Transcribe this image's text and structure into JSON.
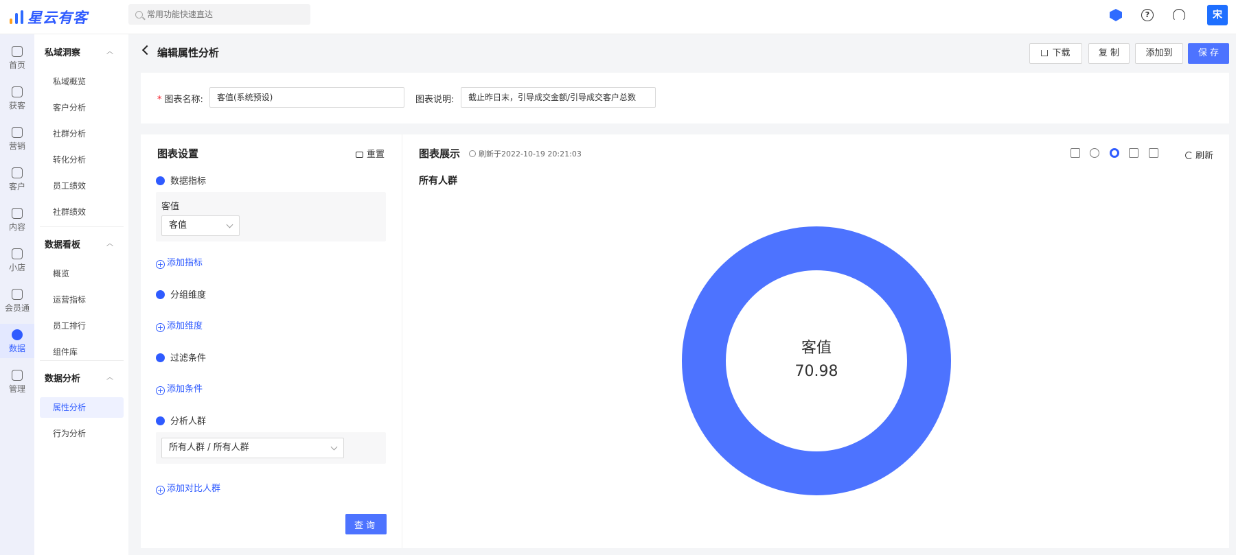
{
  "app": {
    "logo_text": "星云有客",
    "search_placeholder": "常用功能快速直达",
    "avatar_text": "宋"
  },
  "rail": [
    {
      "label": "首页",
      "icon": "home-icon"
    },
    {
      "label": "获客",
      "icon": "acquire-icon"
    },
    {
      "label": "营销",
      "icon": "bulb-icon"
    },
    {
      "label": "客户",
      "icon": "user-icon"
    },
    {
      "label": "内容",
      "icon": "folder-icon"
    },
    {
      "label": "小店",
      "icon": "shop-icon"
    },
    {
      "label": "会员通",
      "icon": "member-icon"
    },
    {
      "label": "数据",
      "icon": "pie-icon",
      "active": true
    },
    {
      "label": "管理",
      "icon": "grid-icon"
    }
  ],
  "subnav": {
    "groups": [
      {
        "title": "私域洞察",
        "items": [
          "私域概览",
          "客户分析",
          "社群分析",
          "转化分析",
          "员工绩效",
          "社群绩效"
        ]
      },
      {
        "title": "数据看板",
        "items": [
          "概览",
          "运营指标",
          "员工排行",
          "组件库"
        ]
      },
      {
        "title": "数据分析",
        "items": [
          "属性分析",
          "行为分析"
        ]
      }
    ],
    "active": "属性分析"
  },
  "header": {
    "title": "编辑属性分析",
    "download": "下载",
    "copy": "复 制",
    "add_to": "添加到",
    "save": "保 存"
  },
  "form": {
    "name_label": "图表名称:",
    "name_value": "客值(系统预设)",
    "desc_label": "图表说明:",
    "desc_value": "截止昨日末，引导成交金额/引导成交客户总数"
  },
  "settings": {
    "title": "图表设置",
    "reset": "重置",
    "metrics_title": "数据指标",
    "metric_name": "客值",
    "metric_select": "客值",
    "add_metric": "添加指标",
    "group_title": "分组维度",
    "add_group": "添加维度",
    "filter_title": "过滤条件",
    "add_filter": "添加条件",
    "audience_title": "分析人群",
    "audience_select": "所有人群 / 所有人群",
    "add_compare": "添加对比人群",
    "query": "查询"
  },
  "chart_panel": {
    "title": "图表展示",
    "refresh_time": "刷新于2022-10-19 20:21:03",
    "refresh": "刷新",
    "audience": "所有人群",
    "chart_types": [
      "number-card-icon",
      "pie-chart-icon",
      "donut-chart-icon",
      "bar-chart-icon",
      "table-icon"
    ]
  },
  "chart_data": {
    "type": "pie",
    "subtype": "donut",
    "categories": [
      "客值"
    ],
    "values": [
      70.98
    ],
    "center_label": "客值",
    "center_value": "70.98",
    "color": "#4d73ff"
  }
}
